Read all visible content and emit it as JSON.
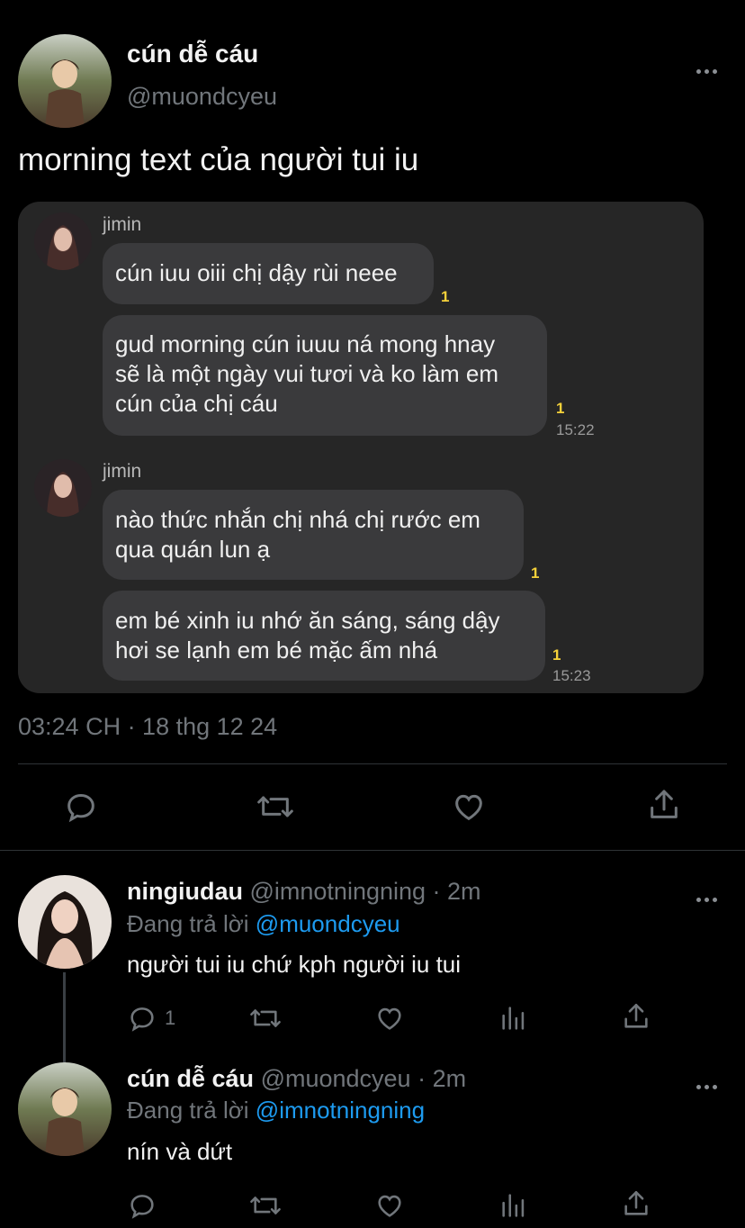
{
  "main_tweet": {
    "display_name": "cún dễ cáu",
    "handle": "@muondcyeu",
    "text": "morning text của người tui iu",
    "timestamp": "03:24 CH · 18 thg 12 24"
  },
  "chat": {
    "groups": [
      {
        "sender": "jimin",
        "messages": [
          {
            "lines": [
              "cún iuu oiii chị dậy rùi neee"
            ],
            "unread": "1",
            "time": ""
          },
          {
            "lines": [
              "gud morning cún iuuu ná mong hnay",
              "sẽ là một ngày vui tươi và ko làm em",
              "cún của chị cáu"
            ],
            "unread": "1",
            "time": "15:22"
          }
        ]
      },
      {
        "sender": "jimin",
        "messages": [
          {
            "lines": [
              "nào thức nhắn chị nhá chị rước em",
              "qua quán lun ạ"
            ],
            "unread": "1",
            "time": ""
          },
          {
            "lines": [
              "em bé xinh iu nhớ ăn sáng, sáng dậy",
              "hơi se lạnh em bé mặc ấm nhá"
            ],
            "unread": "1",
            "time": "15:23"
          }
        ]
      }
    ]
  },
  "replies": [
    {
      "display_name": "ningiudau",
      "handle": "@imnotningning",
      "age": "· 2m",
      "replying_prefix": "Đang trả lời",
      "replying_to": "@muondcyeu",
      "text": "người tui iu chứ kph người iu tui",
      "reply_count": "1"
    },
    {
      "display_name": "cún dễ cáu",
      "handle": "@muondcyeu",
      "age": "· 2m",
      "replying_prefix": "Đang trả lời",
      "replying_to": "@imnotningning",
      "text": "nín và dứt",
      "reply_count": ""
    }
  ],
  "icons": {
    "more": "more-dots-icon",
    "reply": "reply-icon",
    "retweet": "retweet-icon",
    "like": "heart-icon",
    "share": "share-icon",
    "views": "views-icon"
  },
  "colors": {
    "background": "#000000",
    "accent": "#1d9bf0",
    "muted": "#71767b",
    "card": "#262626",
    "bubble": "#3a3a3c",
    "unread": "#f5d13a"
  }
}
